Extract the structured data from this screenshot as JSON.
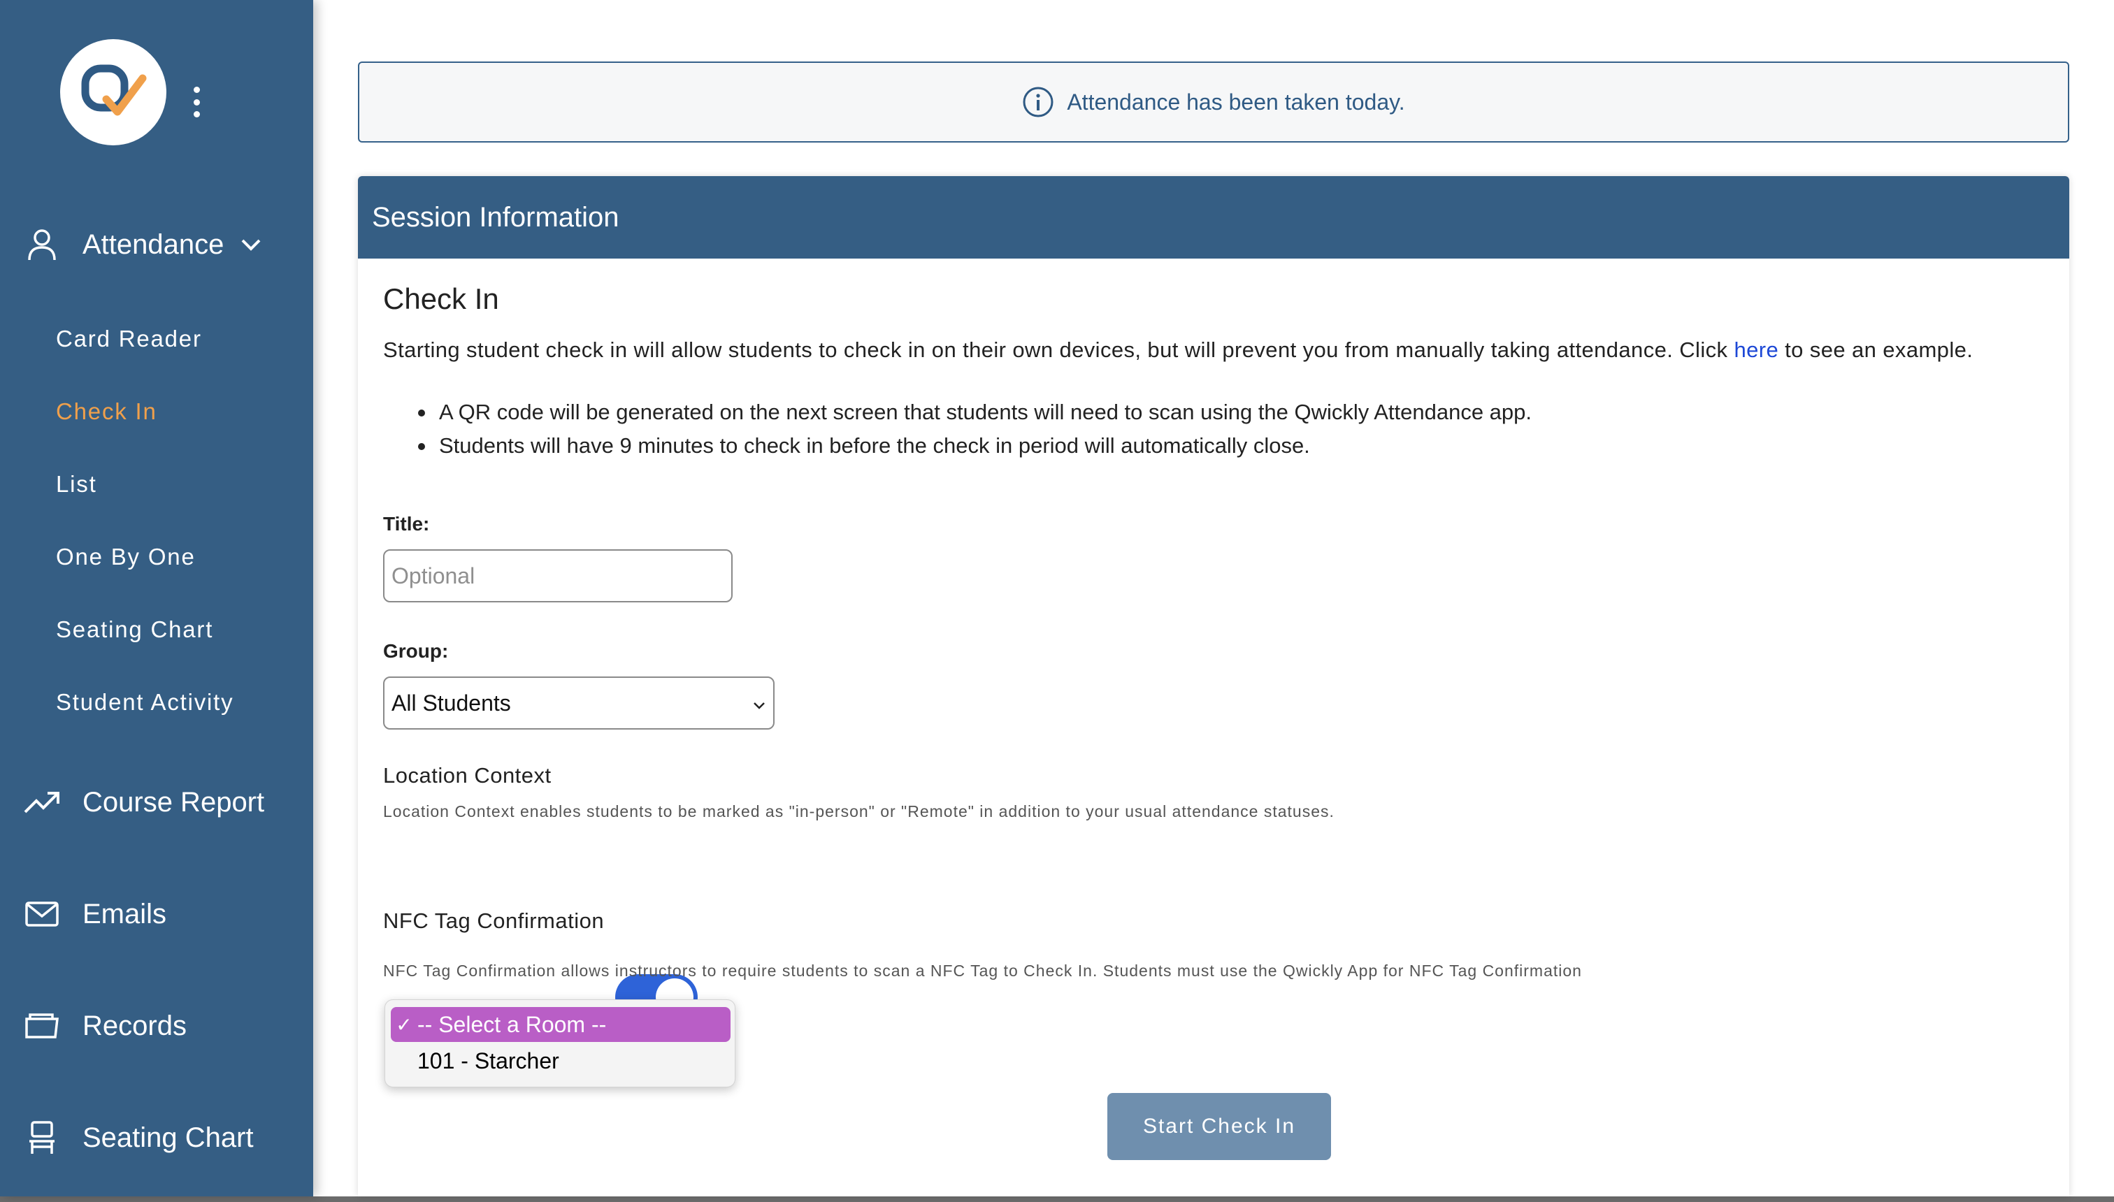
{
  "sidebar": {
    "attendance_label": "Attendance",
    "sub_items": [
      "Card Reader",
      "Check In",
      "List",
      "One By One",
      "Seating Chart",
      "Student Activity"
    ],
    "active_item": "Check In",
    "course_report_label": "Course Report",
    "emails_label": "Emails",
    "records_label": "Records",
    "seating_chart_label": "Seating Chart"
  },
  "alert": {
    "text": "Attendance has been taken today."
  },
  "card": {
    "header": "Session Information",
    "heading": "Check In",
    "description_before": "Starting student check in will allow students to check in on their own devices, but will prevent you from manually taking attendance. Click ",
    "description_link": "here",
    "description_after": " to see an example.",
    "bullets": [
      "A QR code will be generated on the next screen that students will need to scan using the Qwickly Attendance app.",
      "Students will have 9 minutes to check in before the check in period will automatically close."
    ],
    "title_label": "Title:",
    "title_placeholder": "Optional",
    "group_label": "Group:",
    "group_value": "All Students",
    "location_title": "Location Context",
    "location_desc": "Location Context enables students to be marked as \"in-person\" or \"Remote\" in addition to your usual attendance statuses.",
    "nfc_label": "NFC Tag Confirmation",
    "nfc_enabled": true,
    "nfc_desc": "NFC Tag Confirmation allows instructors to require students to scan a NFC Tag to Check In. Students must use the Qwickly App for NFC Tag Confirmation",
    "room_options": [
      "-- Select a Room --",
      "101 - Starcher"
    ],
    "room_selected": "-- Select a Room --",
    "start_button": "Start Check In"
  },
  "colors": {
    "sidebar": "#355e84",
    "accent_orange": "#f0a04b",
    "toggle_blue": "#2e63d8",
    "selected_option": "#b95ec6",
    "button": "#6f8fae"
  }
}
